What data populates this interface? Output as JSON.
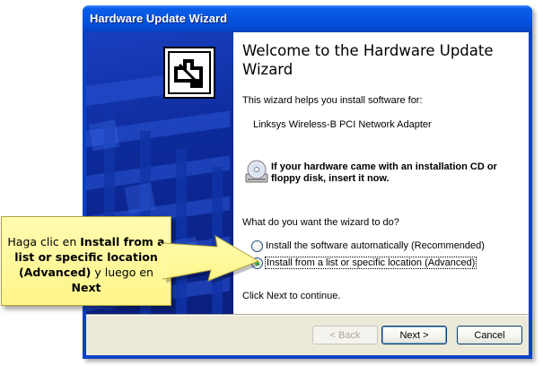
{
  "window": {
    "title": "Hardware Update Wizard"
  },
  "wizard": {
    "heading": "Welcome to the Hardware Update Wizard",
    "intro": "This wizard helps you install software for:",
    "device_name": "Linksys Wireless-B PCI Network Adapter",
    "cd_prompt": "If your hardware came with an installation CD or floppy disk, insert it now.",
    "question": "What do you want the wizard to do?",
    "options": [
      {
        "label": "Install the software automatically (Recommended)",
        "selected": false
      },
      {
        "label": "Install from a list or specific location (Advanced)",
        "selected": true
      }
    ],
    "continue_text": "Click Next to continue."
  },
  "buttons": {
    "back": "< Back",
    "next": "Next >",
    "cancel": "Cancel"
  },
  "callout": {
    "prefix": "Haga clic en ",
    "bold_option": "Install from a list or specific location (Advanced)",
    "middle": " y luego en ",
    "bold_button": "Next",
    "color": "#fff58a"
  },
  "colors": {
    "title_bar": "#0454e0",
    "side_panel": "#0d2a9a",
    "dialog_face": "#ece9d8",
    "callout_bg": "#fff58a"
  },
  "icons": {
    "wizard_icon": "hardware-card-icon",
    "cd_icon": "cd-drive-icon",
    "callout_arrow": "arrow-right-icon"
  }
}
